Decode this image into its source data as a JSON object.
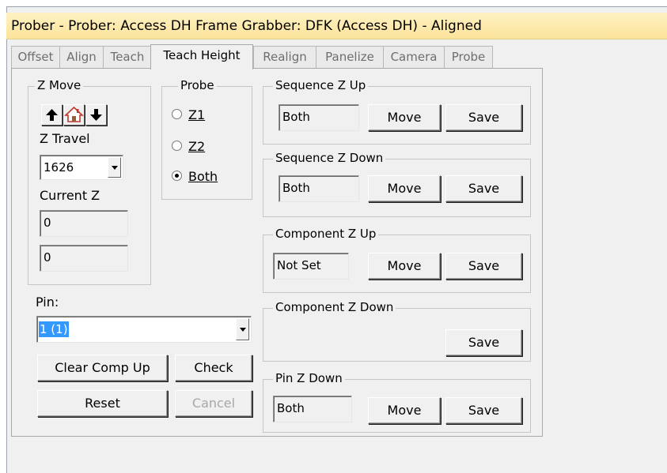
{
  "window": {
    "title": "Prober - Prober: Access DH Frame Grabber: DFK (Access DH) - Aligned"
  },
  "tabs": [
    {
      "label": "Offset",
      "active": false
    },
    {
      "label": "Align",
      "active": false
    },
    {
      "label": "Teach",
      "active": false
    },
    {
      "label": "Teach Height",
      "active": true
    },
    {
      "label": "Realign",
      "active": false
    },
    {
      "label": "Panelize",
      "active": false
    },
    {
      "label": "Camera",
      "active": false
    },
    {
      "label": "Probe",
      "active": false
    }
  ],
  "z_move": {
    "group_label": "Z Move",
    "icons": [
      "arrow-up-icon",
      "home-icon",
      "arrow-down-icon"
    ],
    "z_travel_label": "Z Travel",
    "z_travel_value": "1626",
    "current_z_label": "Current Z",
    "current_z_value_1": "0",
    "current_z_value_2": "0"
  },
  "probe": {
    "group_label": "Probe",
    "options": [
      {
        "label": "Z1",
        "selected": false
      },
      {
        "label": "Z2",
        "selected": false
      },
      {
        "label": "Both",
        "selected": true
      }
    ]
  },
  "pin": {
    "label": "Pin:",
    "value": "1 (1)"
  },
  "buttons": {
    "clear_comp_up": "Clear Comp Up",
    "check": "Check",
    "reset": "Reset",
    "cancel": "Cancel",
    "move": "Move",
    "save": "Save"
  },
  "sections": {
    "sequence_z_up": {
      "label": "Sequence Z Up",
      "value": "Both"
    },
    "sequence_z_down": {
      "label": "Sequence Z Down",
      "value": "Both"
    },
    "component_z_up": {
      "label": "Component Z Up",
      "value": "Not Set"
    },
    "component_z_down": {
      "label": "Component Z Down"
    },
    "pin_z_down": {
      "label": "Pin Z Down",
      "value": "Both"
    }
  },
  "colors": {
    "title_bar": "#fbe39b",
    "selection": "#3399ff"
  }
}
